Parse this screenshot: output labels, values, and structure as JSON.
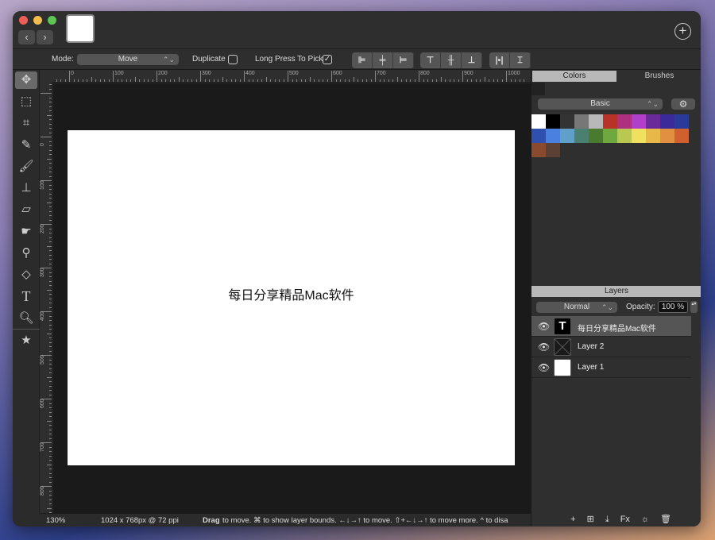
{
  "window": {
    "colors": {
      "close": "#ec5f57",
      "minimize": "#f4bd4f",
      "zoom": "#5fc454"
    },
    "back": "‹",
    "forward": "›",
    "add": "+"
  },
  "toolbar": {
    "mode_label": "Mode:",
    "mode_value": "Move",
    "duplicate_label": "Duplicate",
    "duplicate_checked": false,
    "long_press_label": "Long Press To Pick",
    "long_press_checked": true,
    "check_mark": "✓",
    "align_buttons": [
      "align-left",
      "align-center-h",
      "align-right",
      "align-top",
      "align-center-v",
      "align-bottom"
    ],
    "distribute_buttons": [
      "distribute-horizontal",
      "distribute-vertical"
    ]
  },
  "tools": [
    "move",
    "marquee",
    "crop",
    "eyedropper",
    "brush",
    "stamp",
    "eraser",
    "smudge",
    "dodge",
    "fill",
    "text",
    "zoom",
    "favorites"
  ],
  "rulers": {
    "horizontal": [
      "0",
      "100",
      "200",
      "300",
      "400",
      "500",
      "600",
      "700",
      "800",
      "900",
      "1000"
    ],
    "vertical": [
      "0",
      "100",
      "200",
      "300",
      "400",
      "500",
      "600",
      "700",
      "800"
    ]
  },
  "canvas": {
    "text": "每日分享精品Mac软件",
    "background": "#ffffff"
  },
  "status": {
    "zoom": "130%",
    "size": "1024 x 768px @ 72 ppi",
    "hint_bold": "Drag",
    "hint": "to move.  ⌘ to show layer bounds.  ←↓→↑ to move.  ⇧+←↓→↑ to move more.  ^ to disa"
  },
  "panel": {
    "tabs": [
      "Colors",
      "Brushes"
    ],
    "active_tab": "Colors",
    "palette": "Basic",
    "swatches": [
      "#ffffff",
      "#000000",
      "#333333",
      "#777777",
      "#b8b8b8",
      "#b83227",
      "#b03080",
      "#b040c8",
      "#6a2a9a",
      "#3a2a9a",
      "#2a3a9a",
      "#3050b0",
      "#4a80e0",
      "#60a0c8",
      "#4a8070",
      "#4a7a30",
      "#70a840",
      "#b8c850",
      "#f0e060",
      "#e8b848",
      "#e09040",
      "#d06030",
      "#8a4a30",
      "#5a4035"
    ]
  },
  "layers": {
    "title": "Layers",
    "blend_mode": "Normal",
    "opacity_label": "Opacity:",
    "opacity": "100 %",
    "items": [
      {
        "name": "每日分享精品Mac软件",
        "type": "text",
        "thumb": "T",
        "selected": true
      },
      {
        "name": "Layer 2",
        "type": "empty",
        "selected": false
      },
      {
        "name": "Layer 1",
        "type": "fill",
        "selected": false
      }
    ],
    "actions": [
      "+",
      "⊞",
      "⤓",
      "Fx",
      "☼",
      "🗑"
    ]
  }
}
